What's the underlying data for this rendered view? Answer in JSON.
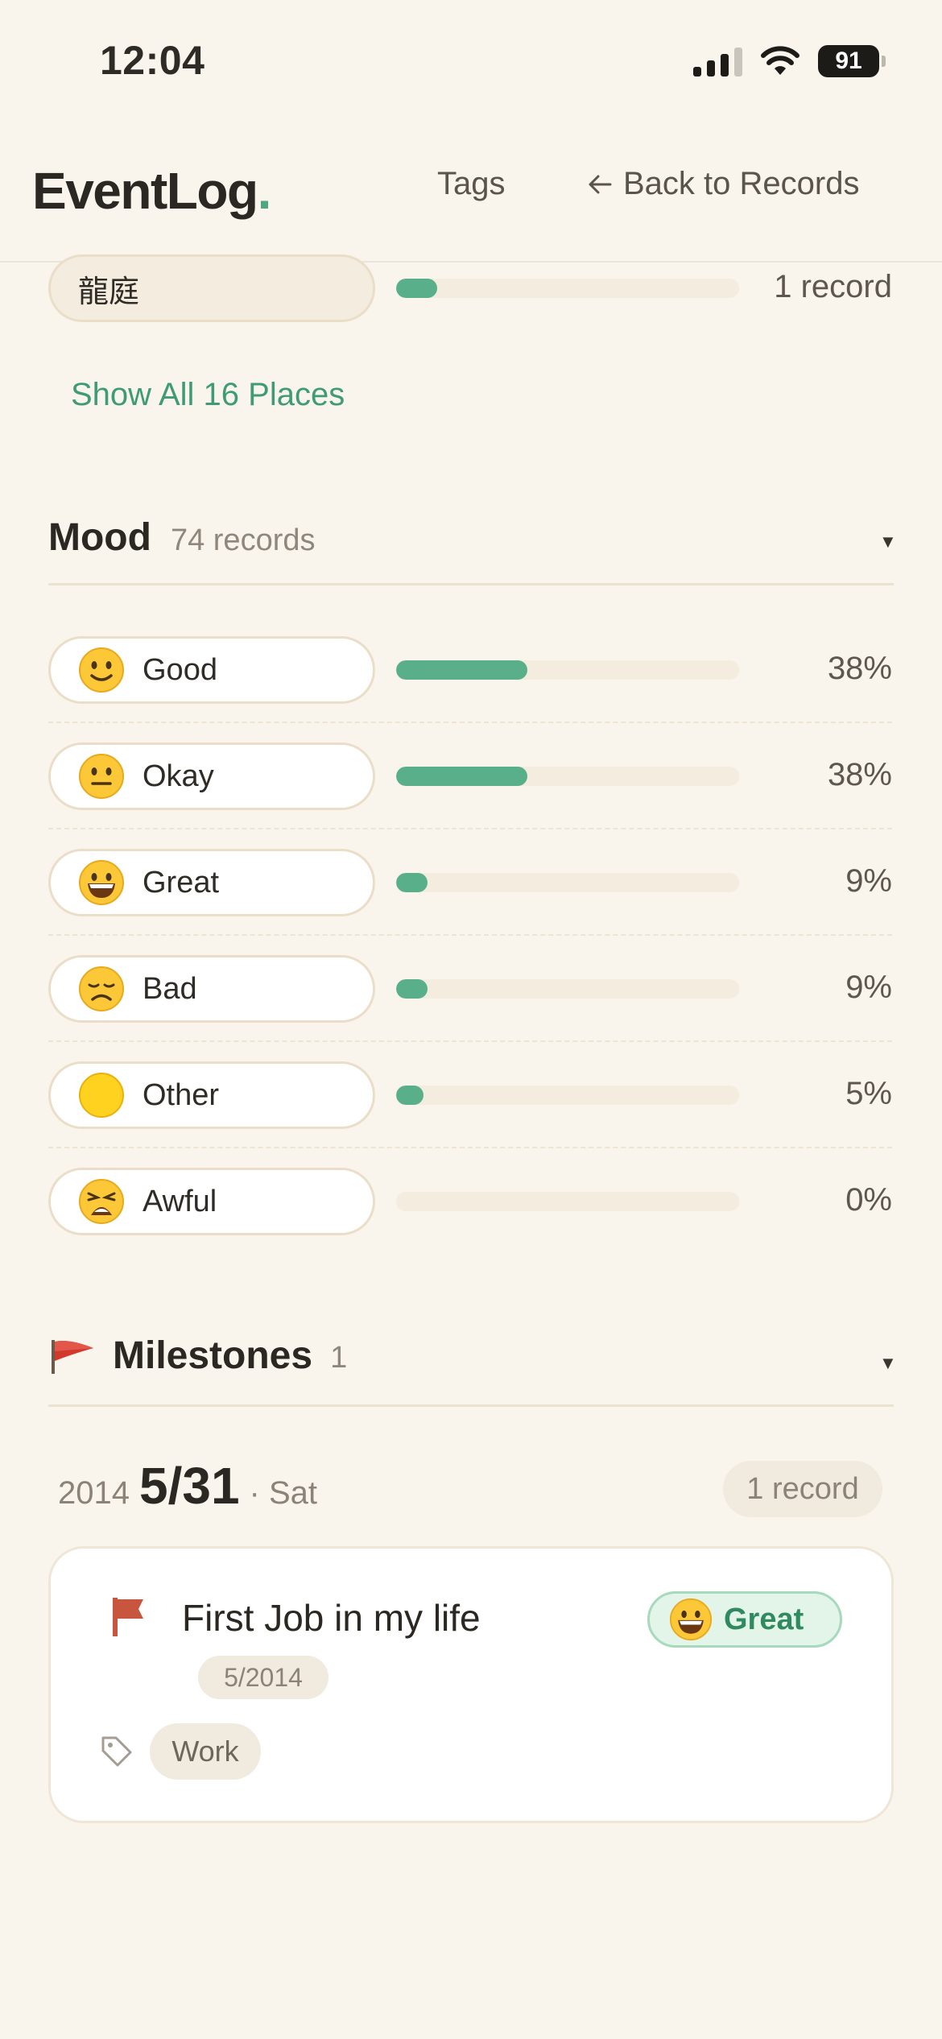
{
  "status_bar": {
    "time": "12:04",
    "battery": "91"
  },
  "header": {
    "logo": "EventLog",
    "logo_dot": ".",
    "nav_tags": "Tags",
    "nav_back": "Back to Records"
  },
  "places": {
    "last_item": {
      "label": "龍庭",
      "value": "1 record",
      "fraction": 0.12
    },
    "show_all": "Show All 16 Places"
  },
  "mood": {
    "title": "Mood",
    "count": "74 records",
    "items": [
      {
        "label": "Good",
        "value": "38%",
        "percent": 38,
        "icon": "slightly-smiling-face-icon"
      },
      {
        "label": "Okay",
        "value": "38%",
        "percent": 38,
        "icon": "neutral-face-icon"
      },
      {
        "label": "Great",
        "value": "9%",
        "percent": 9,
        "icon": "grinning-face-icon"
      },
      {
        "label": "Bad",
        "value": "9%",
        "percent": 9,
        "icon": "disappointed-face-icon"
      },
      {
        "label": "Other",
        "value": "5%",
        "percent": 5,
        "icon": "yellow-circle-icon"
      },
      {
        "label": "Awful",
        "value": "0%",
        "percent": 0,
        "icon": "weary-face-icon"
      }
    ]
  },
  "milestones": {
    "title": "Milestones",
    "count": "1",
    "group": {
      "year": "2014",
      "date": "5/31",
      "weekday": "· Sat",
      "record_count": "1 record",
      "entry": {
        "title": "First Job in my life",
        "date": "5/2014",
        "mood": "Great",
        "tag": "Work"
      }
    }
  },
  "colors": {
    "accent": "#5aaf8b",
    "link": "#3f9a76",
    "background": "#f9f4ec",
    "flag": "#c8553d"
  }
}
